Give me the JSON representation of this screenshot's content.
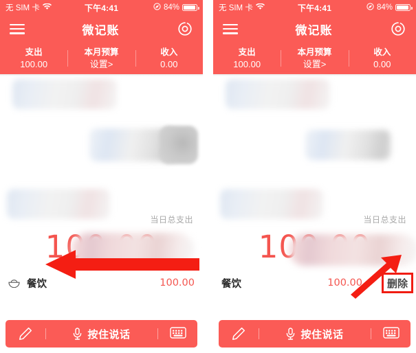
{
  "app": {
    "title": "微记账",
    "accent_color": "#fb5b56",
    "amount_color": "#f4554f",
    "annotation_color": "#f01c12"
  },
  "status_bar": {
    "carrier": "无 SIM 卡",
    "wifi_icon": "wifi-icon",
    "time": "下午4:41",
    "location_icon": "location-arrow-icon",
    "battery_percent": "84%",
    "battery_icon": "battery-icon"
  },
  "app_bar": {
    "menu_icon": "hamburger-menu-icon",
    "title": "微记账",
    "chart_icon": "pie-chart-icon"
  },
  "stats": [
    {
      "label": "支出",
      "value": "100.00",
      "name": "expense"
    },
    {
      "label": "本月预算",
      "value": "设置>",
      "name": "budget"
    },
    {
      "label": "收入",
      "value": "0.00",
      "name": "income"
    }
  ],
  "summary": {
    "total_label": "当日总支出",
    "total_amount": "100.00"
  },
  "entry": {
    "category_icon": "bowl-icon",
    "category": "餐饮",
    "amount": "100.00"
  },
  "delete": {
    "label": "删除"
  },
  "bottom_bar": {
    "pencil_icon": "pencil-icon",
    "mic_icon": "microphone-icon",
    "speak_label": "按住说话",
    "keyboard_icon": "keyboard-icon"
  }
}
